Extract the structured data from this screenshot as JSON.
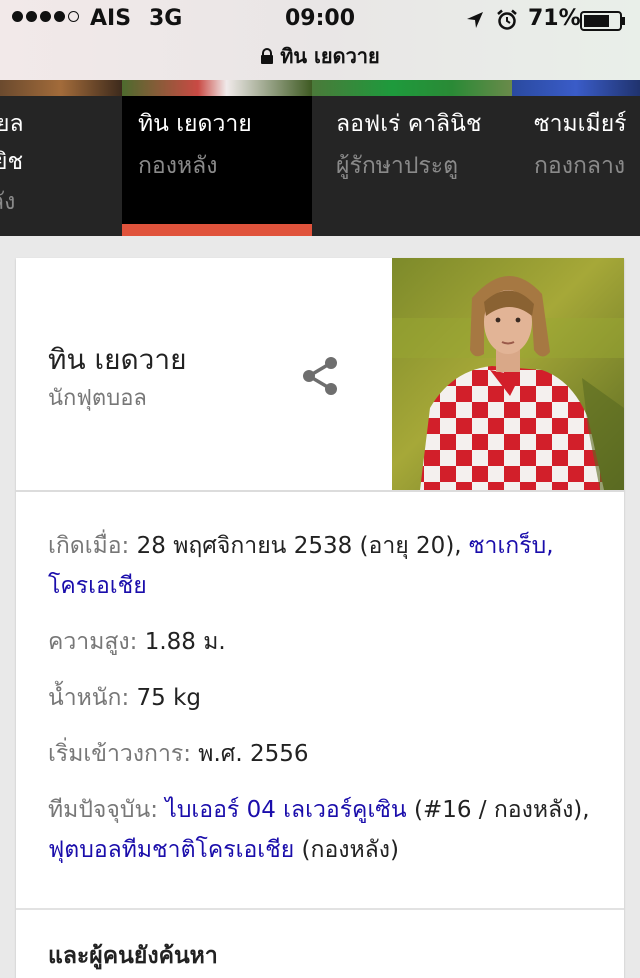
{
  "status": {
    "carrier": "AIS",
    "network": "3G",
    "time": "09:00",
    "battery": "71%",
    "url": "ทิน เยดวาย",
    "icons": [
      "location-arrow-icon",
      "alarm-clock-icon",
      "battery-icon",
      "lock-icon"
    ]
  },
  "carousel": {
    "items": [
      {
        "name": "ยล",
        "extra": "ยิช",
        "role": "ลัง"
      },
      {
        "name": "ทิน เยดวาย",
        "role": "กองหลัง"
      },
      {
        "name": "ลอฟเร่ คาลินิช",
        "role": "ผู้รักษาประตู"
      },
      {
        "name": "ซามเมียร์",
        "role": "กองกลาง"
      }
    ],
    "active_color": "#e0533c"
  },
  "card": {
    "title": "ทิน เยดวาย",
    "subtitle": "นักฟุตบอล",
    "facts": {
      "born_label": "เกิดเมื่อ:",
      "born_value": "28 พฤศจิกายน 2538 (อายุ 20),",
      "born_place": "ซาเกร็บ, โครเอเชีย",
      "height_label": "ความสูง:",
      "height_value": "1.88 ม.",
      "weight_label": "น้ำหนัก:",
      "weight_value": "75 kg",
      "debut_label": "เริ่มเข้าวงการ:",
      "debut_value": "พ.ศ. 2556",
      "team_label": "ทีมปัจจุบัน:",
      "team_club": "ไบเออร์ 04 เลเวอร์คูเซิน",
      "team_club_note": " (#16 / กองหลัง), ",
      "team_national": "ฟุตบอลทีมชาติโครเอเชีย",
      "team_national_note": " (กองหลัง)"
    },
    "people_also_search": "และผู้คนยังค้นหา",
    "link_color": "#1a0dab"
  }
}
